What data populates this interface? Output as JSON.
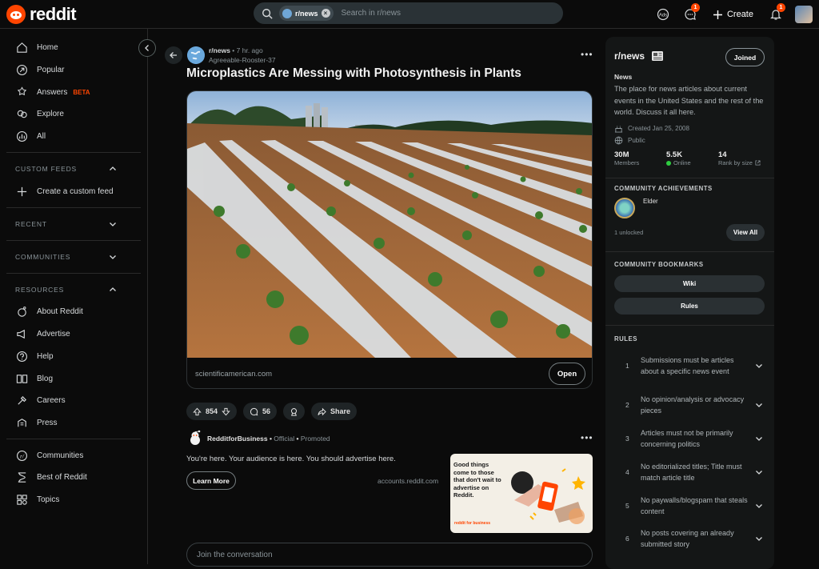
{
  "header": {
    "logo_text": "reddit",
    "search_chip": "r/news",
    "search_placeholder": "Search in r/news",
    "chat_badge": "1",
    "create_label": "Create",
    "notif_badge": "1"
  },
  "sidebar": {
    "top": [
      {
        "label": "Home",
        "icon": "home-icon"
      },
      {
        "label": "Popular",
        "icon": "popular-icon"
      },
      {
        "label": "Answers",
        "icon": "answers-icon",
        "badge": "BETA"
      },
      {
        "label": "Explore",
        "icon": "explore-icon"
      },
      {
        "label": "All",
        "icon": "all-icon"
      }
    ],
    "custom_feeds_header": "CUSTOM FEEDS",
    "create_feed_label": "Create a custom feed",
    "recent_header": "RECENT",
    "communities_header": "COMMUNITIES",
    "resources_header": "RESOURCES",
    "resources": [
      {
        "label": "About Reddit",
        "icon": "about-icon"
      },
      {
        "label": "Advertise",
        "icon": "advertise-icon"
      },
      {
        "label": "Help",
        "icon": "help-icon"
      },
      {
        "label": "Blog",
        "icon": "blog-icon"
      },
      {
        "label": "Careers",
        "icon": "careers-icon"
      },
      {
        "label": "Press",
        "icon": "press-icon"
      }
    ],
    "bottom": [
      {
        "label": "Communities",
        "icon": "communities-icon"
      },
      {
        "label": "Best of Reddit",
        "icon": "best-icon"
      },
      {
        "label": "Topics",
        "icon": "topics-icon"
      }
    ]
  },
  "post": {
    "subreddit": "r/news",
    "time": "7 hr. ago",
    "author": "Agreeable-Rooster-37",
    "title": "Microplastics Are Messing with Photosynthesis in Plants",
    "link_domain": "scientificamerican.com",
    "open_label": "Open",
    "votes": "854",
    "comments": "56",
    "share_label": "Share"
  },
  "promo": {
    "name": "RedditforBusiness",
    "official": "Official",
    "promoted": "Promoted",
    "text": "You're here. Your audience is here. You should advertise here.",
    "learn_more": "Learn More",
    "domain": "accounts.reddit.com",
    "ad_headline": "Good things come to those that don't wait to advertise on Reddit.",
    "ad_footer": "reddit for business"
  },
  "comment_placeholder": "Join the conversation",
  "community": {
    "name": "r/news",
    "joined_label": "Joined",
    "title": "News",
    "description": "The place for news articles about current events in the United States and the rest of the world. Discuss it all here.",
    "created": "Created Jan 25, 2008",
    "visibility": "Public",
    "members_value": "30M",
    "members_label": "Members",
    "online_value": "5.5K",
    "online_label": "Online",
    "rank_value": "14",
    "rank_label": "Rank by size",
    "achievements_header": "COMMUNITY ACHIEVEMENTS",
    "achievement_name": "Elder",
    "unlocked": "1 unlocked",
    "view_all": "View All",
    "bookmarks_header": "COMMUNITY BOOKMARKS",
    "bookmarks": [
      "Wiki",
      "Rules"
    ],
    "rules_header": "RULES",
    "rules": [
      {
        "n": "1",
        "text": "Submissions must be articles about a specific news event"
      },
      {
        "n": "2",
        "text": "No opinion/analysis or advocacy pieces"
      },
      {
        "n": "3",
        "text": "Articles must not be primarily concerning politics"
      },
      {
        "n": "4",
        "text": "No editorialized titles; Title must match article title"
      },
      {
        "n": "5",
        "text": "No paywalls/blogspam that steals content"
      },
      {
        "n": "6",
        "text": "No posts covering an already submitted story"
      }
    ]
  },
  "colors": {
    "accent": "#ff4500",
    "background": "#0b0b0b",
    "panel": "#141616",
    "online": "#2ecc40"
  }
}
